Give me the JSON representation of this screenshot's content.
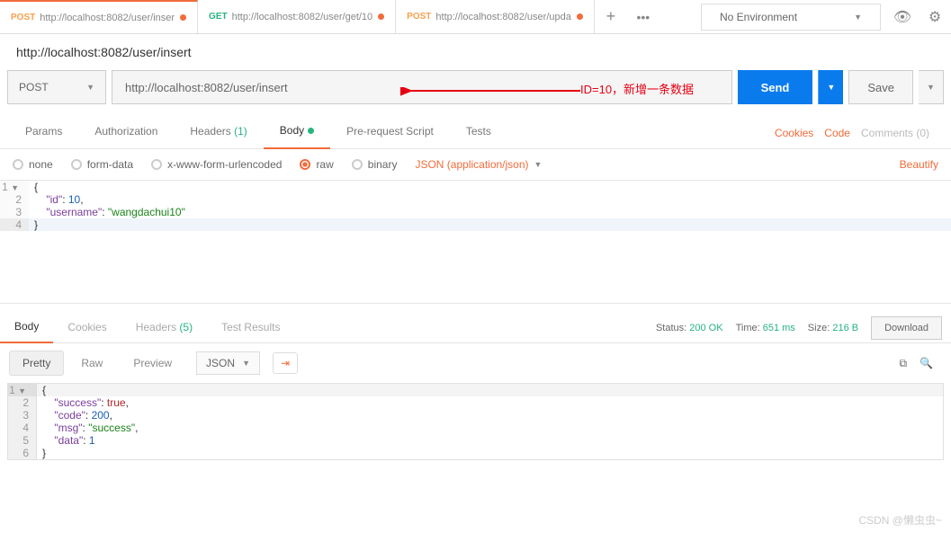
{
  "tabs": [
    {
      "method": "POST",
      "url": "http://localhost:8082/user/inser"
    },
    {
      "method": "GET",
      "url": "http://localhost:8082/user/get/10"
    },
    {
      "method": "POST",
      "url": "http://localhost:8082/user/upda"
    }
  ],
  "env": {
    "label": "No Environment"
  },
  "request": {
    "title": "http://localhost:8082/user/insert",
    "method": "POST",
    "url": "http://localhost:8082/user/insert",
    "annotation": "ID=10，新增一条数据",
    "send": "Send",
    "save": "Save"
  },
  "req_tabs": {
    "params": "Params",
    "auth": "Authorization",
    "headers": "Headers",
    "headers_count": "(1)",
    "body": "Body",
    "prereq": "Pre-request Script",
    "tests": "Tests"
  },
  "right_links": {
    "cookies": "Cookies",
    "code": "Code",
    "comments": "Comments (0)"
  },
  "body_types": {
    "none": "none",
    "formdata": "form-data",
    "urlenc": "x-www-form-urlencoded",
    "raw": "raw",
    "binary": "binary"
  },
  "content_type": "JSON (application/json)",
  "beautify": "Beautify",
  "req_body": {
    "l1": "{",
    "l2_key": "\"id\"",
    "l2_sep": ": ",
    "l2_val": "10",
    "l2_end": ",",
    "l3_key": "\"username\"",
    "l3_sep": ": ",
    "l3_val": "\"wangdachui10\"",
    "l4": "}"
  },
  "resp_tabs": {
    "body": "Body",
    "cookies": "Cookies",
    "headers": "Headers",
    "headers_count": "(5)",
    "tests": "Test Results"
  },
  "resp_meta": {
    "status_label": "Status:",
    "status_val": "200 OK",
    "time_label": "Time:",
    "time_val": "651 ms",
    "size_label": "Size:",
    "size_val": "216 B",
    "download": "Download"
  },
  "resp_toolbar": {
    "pretty": "Pretty",
    "raw": "Raw",
    "preview": "Preview",
    "format": "JSON"
  },
  "resp_body": {
    "l1": "{",
    "l2_k": "\"success\"",
    "l2_v": "true",
    "l3_k": "\"code\"",
    "l3_v": "200",
    "l4_k": "\"msg\"",
    "l4_v": "\"success\"",
    "l5_k": "\"data\"",
    "l5_v": "1",
    "l6": "}"
  },
  "watermark": "CSDN @懒虫虫~",
  "chart_data": null
}
